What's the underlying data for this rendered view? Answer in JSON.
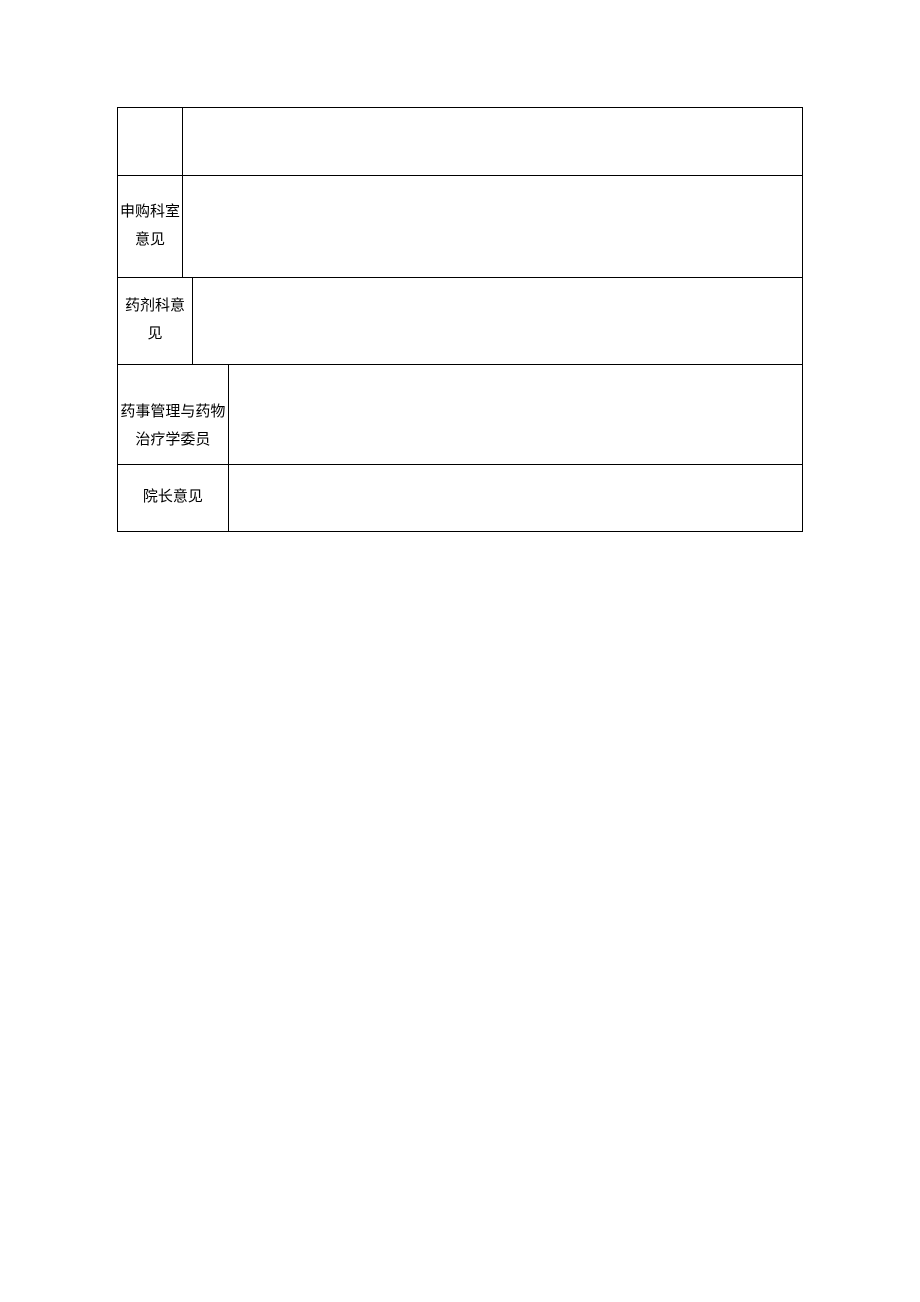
{
  "rows": [
    {
      "label": "",
      "value": ""
    },
    {
      "label": "申购科室意见",
      "value": ""
    },
    {
      "label": "药剂科意见",
      "value": ""
    },
    {
      "label": "药事管理与药物治疗学委员",
      "value": ""
    },
    {
      "label": "院长意见",
      "value": ""
    }
  ]
}
